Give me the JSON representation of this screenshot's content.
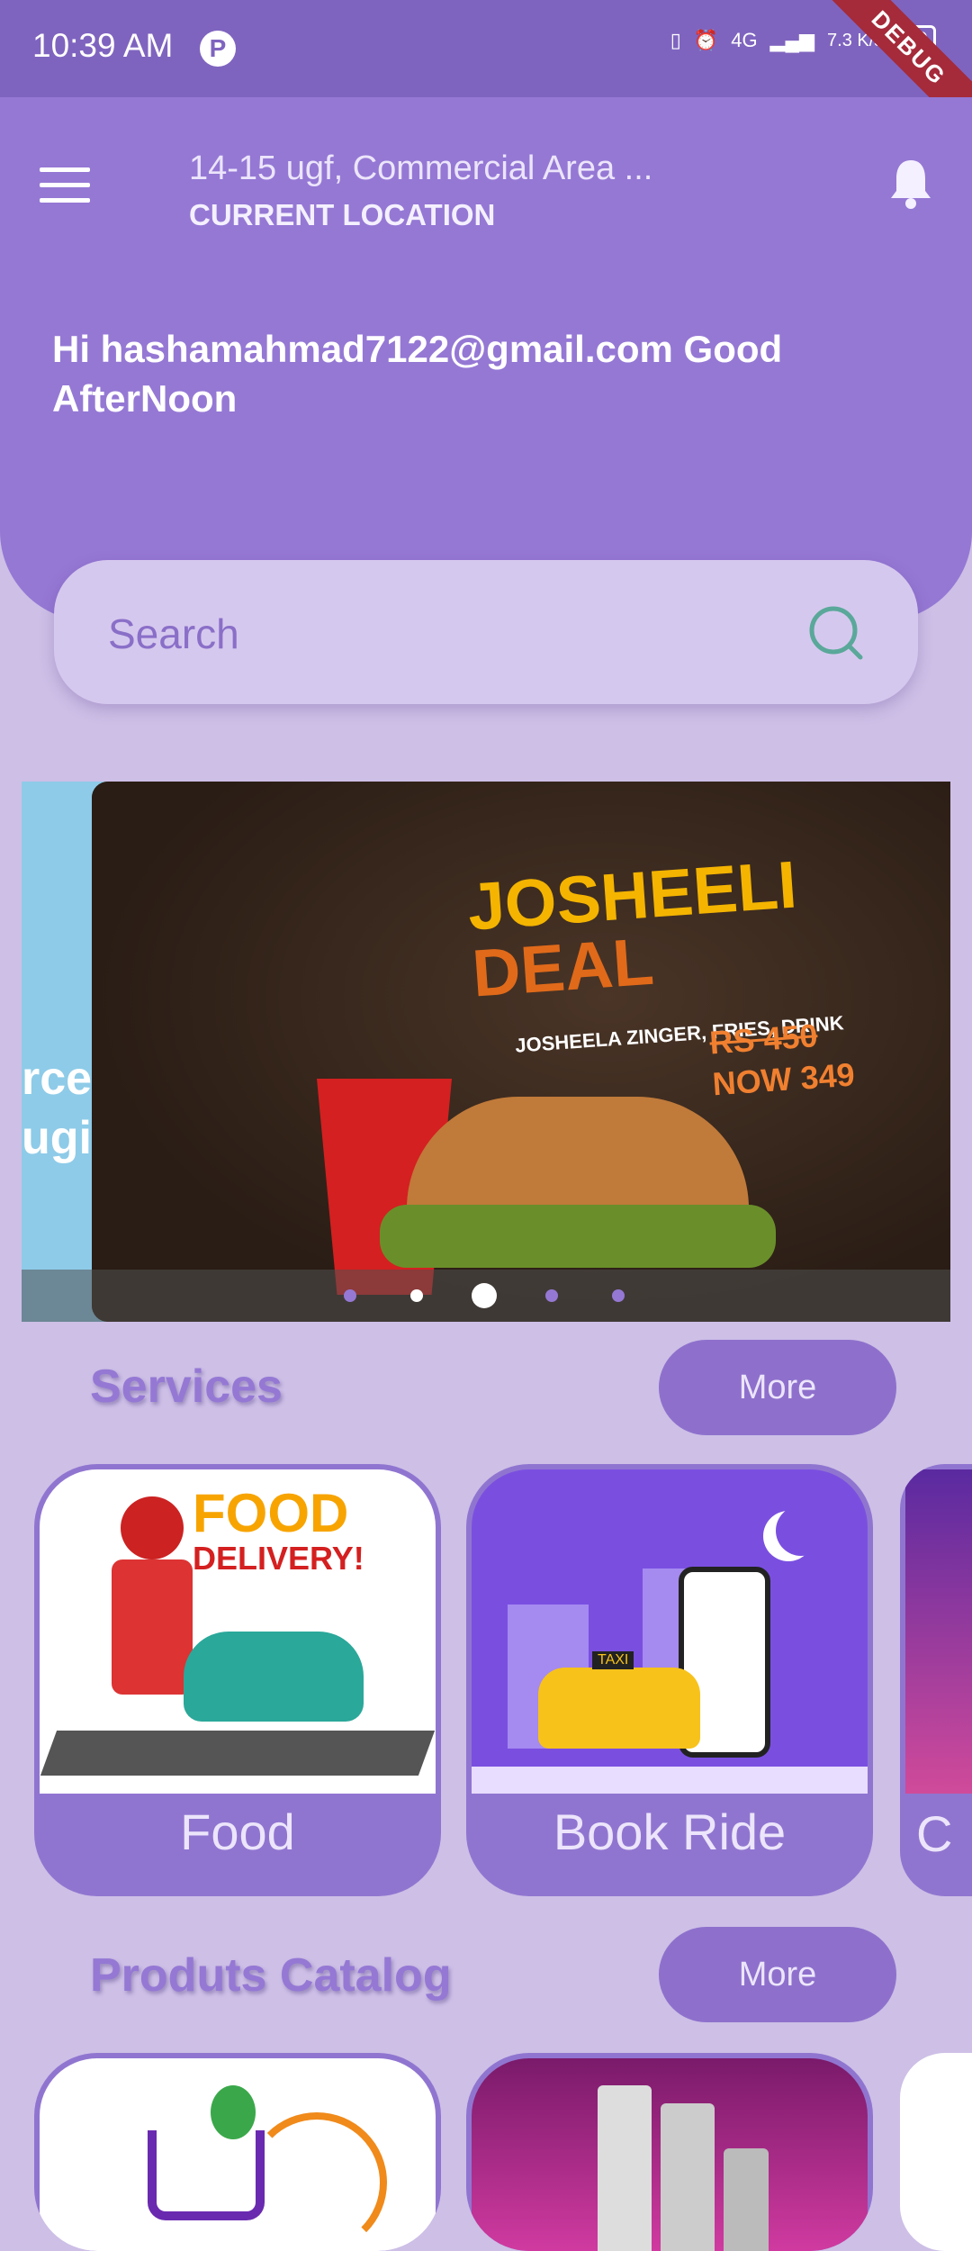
{
  "status_bar": {
    "time": "10:39 AM",
    "net_speed": "7.3 K/s",
    "network": "4G",
    "battery": "60",
    "debug_banner": "DEBUG"
  },
  "header": {
    "address": "14-15 ugf, Commercial Area ...",
    "location_label": "CURRENT LOCATION",
    "greeting": "Hi hashamahmad7122@gmail.com  Good AfterNoon"
  },
  "search": {
    "placeholder": "Search"
  },
  "carousel": {
    "prev_slide_text_1": "rce",
    "prev_slide_text_2": "ugir",
    "banner": {
      "title_line1": "JOSHEELI",
      "title_line2": "DEAL",
      "subtitle": "JOSHEELA ZINGER, FRIES, DRINK",
      "old_price": "RS 450",
      "new_price": "NOW 349"
    },
    "dot_count": 5,
    "active_dot": 3
  },
  "services": {
    "title": "Services",
    "more_label": "More",
    "items": [
      {
        "label": "Food",
        "image_text_1": "FOOD",
        "image_text_2": "DELIVERY!"
      },
      {
        "label": "Book Ride",
        "image_text": "TAXI"
      },
      {
        "label": "C"
      }
    ]
  },
  "products": {
    "title": "Produts Catalog",
    "more_label": "More"
  },
  "colors": {
    "header": "#9578d4",
    "status_bar": "#7f64bf",
    "background": "#cdbfe6",
    "accent": "#8e70cc"
  }
}
